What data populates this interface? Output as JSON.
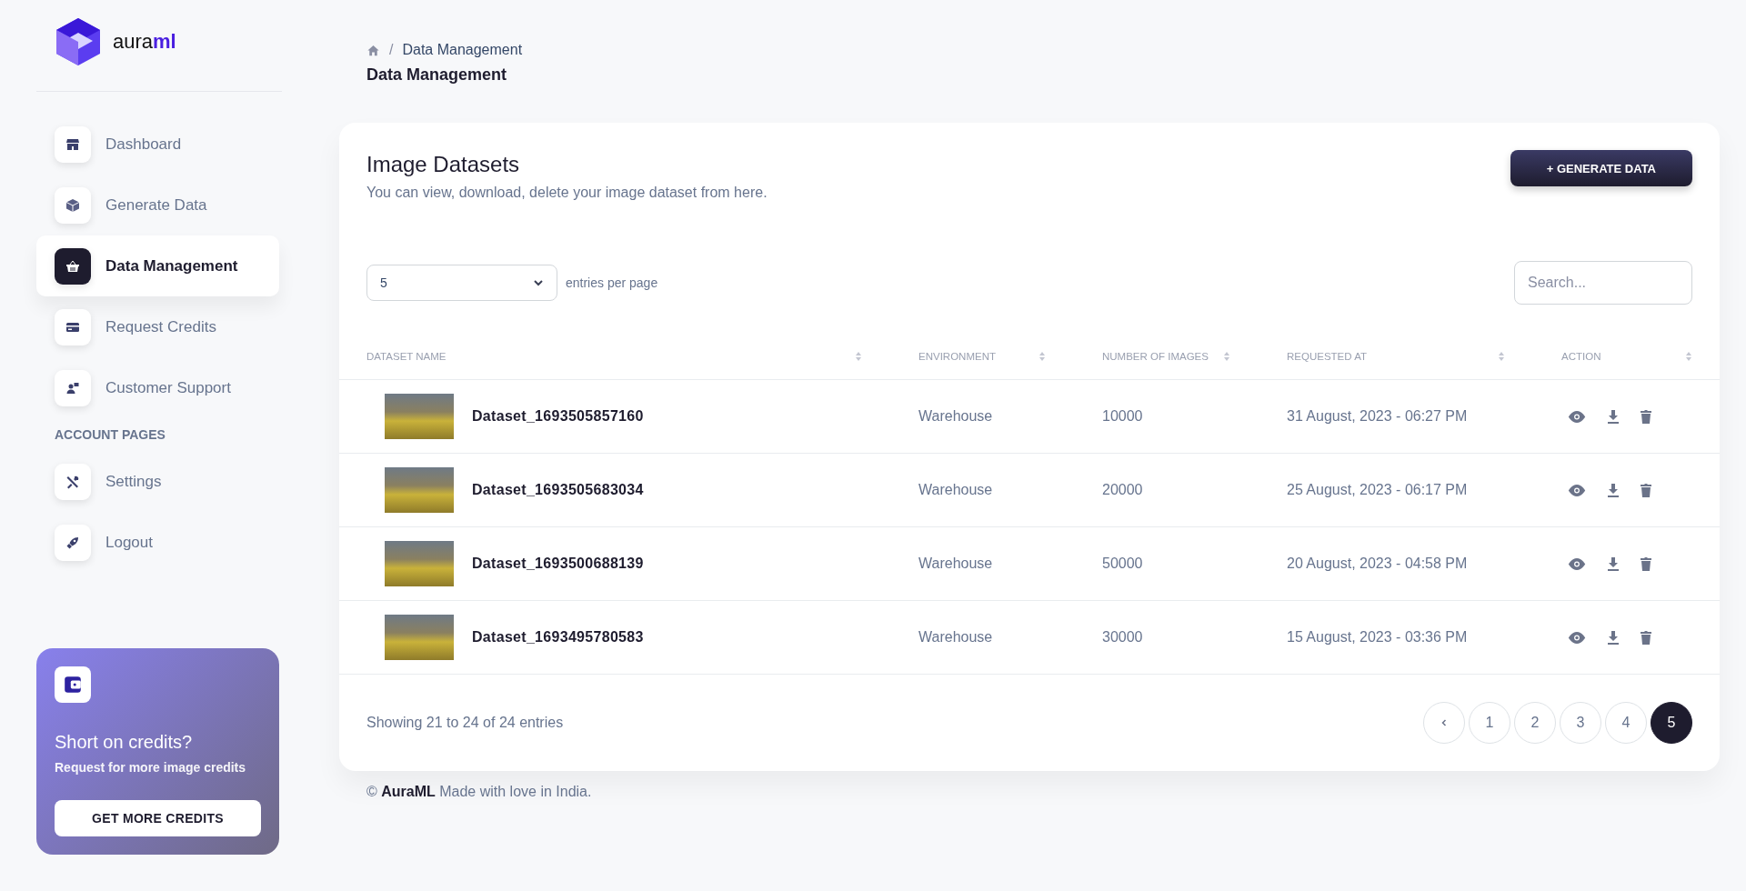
{
  "brand": {
    "text": "aura",
    "accent": "ml"
  },
  "sidebar": {
    "items": [
      {
        "label": "Dashboard",
        "selected": false
      },
      {
        "label": "Generate Data",
        "selected": false
      },
      {
        "label": "Data Management",
        "selected": true
      },
      {
        "label": "Request Credits",
        "selected": false
      },
      {
        "label": "Customer Support",
        "selected": false
      }
    ],
    "section_title": "ACCOUNT PAGES",
    "account_items": [
      {
        "label": "Settings",
        "selected": false
      },
      {
        "label": "Logout",
        "selected": false
      }
    ],
    "promo": {
      "title": "Short on credits?",
      "text": "Request for more image credits",
      "button": "GET MORE CREDITS"
    }
  },
  "breadcrumb": {
    "separator": "/",
    "current": "Data Management"
  },
  "page_title": "Data Management",
  "card": {
    "title": "Image Datasets",
    "subtitle": "You can view, download, delete your image dataset from here.",
    "button": "+ GENERATE DATA"
  },
  "page_size": {
    "value": "5",
    "label": "entries per page"
  },
  "search": {
    "placeholder": "Search..."
  },
  "table": {
    "columns": [
      "DATASET NAME",
      "ENVIRONMENT",
      "NUMBER OF IMAGES",
      "REQUESTED AT",
      "ACTION"
    ],
    "rows": [
      {
        "name": "Dataset_1693505857160",
        "environment": "Warehouse",
        "images": "10000",
        "requested_at": "31 August, 2023 - 06:27 PM"
      },
      {
        "name": "Dataset_1693505683034",
        "environment": "Warehouse",
        "images": "20000",
        "requested_at": "25 August, 2023 - 06:17 PM"
      },
      {
        "name": "Dataset_1693500688139",
        "environment": "Warehouse",
        "images": "50000",
        "requested_at": "20 August, 2023 - 04:58 PM"
      },
      {
        "name": "Dataset_1693495780583",
        "environment": "Warehouse",
        "images": "30000",
        "requested_at": "15 August, 2023 - 03:36 PM"
      }
    ]
  },
  "summary": "Showing 21 to 24 of 24 entries",
  "pagination": [
    {
      "label": "1",
      "selected": false
    },
    {
      "label": "2",
      "selected": false
    },
    {
      "label": "3",
      "selected": false
    },
    {
      "label": "4",
      "selected": false
    },
    {
      "label": "5",
      "selected": true
    }
  ],
  "footer": "© **AuraML** Made with love in India."
}
